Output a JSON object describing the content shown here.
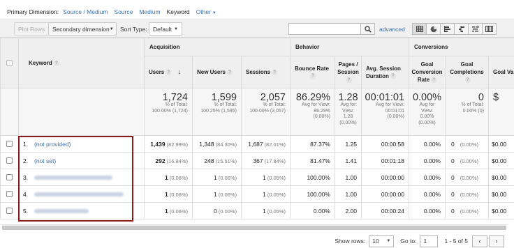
{
  "dimension_bar": {
    "label": "Primary Dimension:",
    "options": [
      "Source / Medium",
      "Source",
      "Medium",
      "Keyword"
    ],
    "active": "Keyword",
    "other": "Other"
  },
  "toolbar": {
    "plot_rows": "Plot Rows",
    "secondary_dimension": "Secondary dimension",
    "sort_type_label": "Sort Type:",
    "sort_type_value": "Default",
    "search_value": "",
    "advanced": "advanced"
  },
  "table": {
    "groups": {
      "acquisition": "Acquisition",
      "behavior": "Behavior",
      "conversions": "Conversions"
    },
    "headers": {
      "keyword": "Keyword",
      "users": "Users",
      "new_users": "New Users",
      "sessions": "Sessions",
      "bounce_rate": "Bounce Rate",
      "pages_session_1": "Pages /",
      "pages_session_2": "Session",
      "avg_session_1": "Avg. Session",
      "avg_session_2": "Duration",
      "goal_conv_1": "Goal",
      "goal_conv_2": "Conversion",
      "goal_conv_3": "Rate",
      "goal_comp_1": "Goal",
      "goal_comp_2": "Completions",
      "goal_value": "Goal Va"
    },
    "totals": {
      "users": {
        "value": "1,724",
        "sub1": "% of Total:",
        "sub2": "100.00% (1,724)"
      },
      "new_users": {
        "value": "1,599",
        "sub1": "% of Total:",
        "sub2": "100.25% (1,595)"
      },
      "sessions": {
        "value": "2,057",
        "sub1": "% of Total:",
        "sub2": "100.00% (2,057)"
      },
      "bounce_rate": {
        "value": "86.29%",
        "sub1": "Avg for View:",
        "sub2": "86.29%",
        "sub3": "(0.00%)"
      },
      "pages_session": {
        "value": "1.28",
        "sub1": "Avg for",
        "sub2": "View:",
        "sub3": "1.28",
        "sub4": "(0.00%)"
      },
      "avg_duration": {
        "value": "00:01:01",
        "sub1": "Avg for View:",
        "sub2": "00:01:01",
        "sub3": "(0.00%)"
      },
      "goal_conv": {
        "value": "0.00%",
        "sub1": "Avg for",
        "sub2": "View:",
        "sub3": "0.00%",
        "sub4": "(0.00%)"
      },
      "goal_comp": {
        "value": "0",
        "sub1": "% of Total:",
        "sub2": "0.00% (0)"
      },
      "goal_value": {
        "value": "$"
      }
    },
    "rows": [
      {
        "idx": "1.",
        "keyword": "(not provided)",
        "users": "1,439",
        "users_pct": "(82.99%)",
        "new_users": "1,348",
        "new_users_pct": "(84.30%)",
        "sessions": "1,687",
        "sessions_pct": "(82.01%)",
        "bounce": "87.37%",
        "pages": "1.25",
        "duration": "00:00:58",
        "conv": "0.00%",
        "comp": "0",
        "comp_pct": "(0.00%)",
        "value": "$0.00"
      },
      {
        "idx": "2.",
        "keyword": "(not set)",
        "users": "292",
        "users_pct": "(16.84%)",
        "new_users": "248",
        "new_users_pct": "(15.51%)",
        "sessions": "367",
        "sessions_pct": "(17.84%)",
        "bounce": "81.47%",
        "pages": "1.41",
        "duration": "00:01:18",
        "conv": "0.00%",
        "comp": "0",
        "comp_pct": "(0.00%)",
        "value": "$0.00"
      },
      {
        "idx": "3.",
        "keyword": "",
        "users": "1",
        "users_pct": "(0.06%)",
        "new_users": "1",
        "new_users_pct": "(0.06%)",
        "sessions": "1",
        "sessions_pct": "(0.05%)",
        "bounce": "100.00%",
        "pages": "1.00",
        "duration": "00:00:00",
        "conv": "0.00%",
        "comp": "0",
        "comp_pct": "(0.00%)",
        "value": "$0.00"
      },
      {
        "idx": "4.",
        "keyword": "",
        "users": "1",
        "users_pct": "(0.06%)",
        "new_users": "1",
        "new_users_pct": "(0.06%)",
        "sessions": "1",
        "sessions_pct": "(0.05%)",
        "bounce": "100.00%",
        "pages": "1.00",
        "duration": "00:00:00",
        "conv": "0.00%",
        "comp": "0",
        "comp_pct": "(0.00%)",
        "value": "$0.00"
      },
      {
        "idx": "5.",
        "keyword": "",
        "users": "1",
        "users_pct": "(0.06%)",
        "new_users": "0",
        "new_users_pct": "(0.00%)",
        "sessions": "1",
        "sessions_pct": "(0.05%)",
        "bounce": "0.00%",
        "pages": "2.00",
        "duration": "00:00:24",
        "conv": "0.00%",
        "comp": "0",
        "comp_pct": "(0.00%)",
        "value": "$0.00"
      }
    ]
  },
  "pagination": {
    "show_rows_label": "Show rows:",
    "show_rows_value": "10",
    "goto_label": "Go to:",
    "goto_value": "1",
    "range": "1 - 5 of 5"
  },
  "colors": {
    "link": "#3a6fb0",
    "highlight_border": "#8b1a1a",
    "header_bg": "#efefef"
  },
  "icons": [
    "search-icon",
    "table-view-icon",
    "pie-view-icon",
    "bar-view-icon",
    "comparison-view-icon",
    "term-cloud-view-icon",
    "pivot-view-icon",
    "help-icon",
    "sort-arrow-icon",
    "prev-page-icon",
    "next-page-icon"
  ]
}
